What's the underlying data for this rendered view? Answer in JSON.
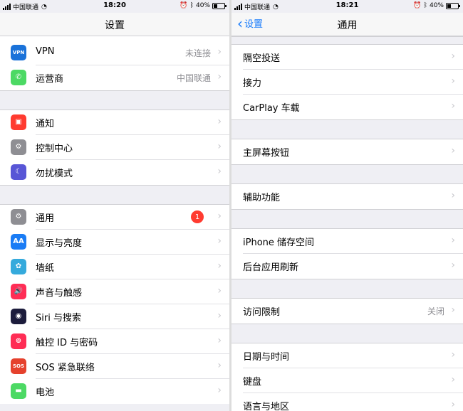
{
  "left": {
    "status": {
      "carrier": "中国联通",
      "time": "18:20",
      "battery": "40%"
    },
    "title": "设置",
    "groups": [
      [
        {
          "label": "VPN",
          "detail": "未连接",
          "icon": "vpn-icon",
          "icon_text": "VPN",
          "color": "#1a72d9"
        },
        {
          "label": "运营商",
          "detail": "中国联通",
          "icon": "phone-icon",
          "icon_text": "✆",
          "color": "#4cd964"
        }
      ],
      [
        {
          "label": "通知",
          "icon": "notification-icon",
          "icon_text": "▣",
          "color": "#ff3b30"
        },
        {
          "label": "控制中心",
          "icon": "control-center-icon",
          "icon_text": "⚙",
          "color": "#8e8e93"
        },
        {
          "label": "勿扰模式",
          "icon": "moon-icon",
          "icon_text": "☾",
          "color": "#5856d6"
        }
      ],
      [
        {
          "label": "通用",
          "badge": "1",
          "icon": "gear-icon",
          "icon_text": "⚙",
          "color": "#8e8e93"
        },
        {
          "label": "显示与亮度",
          "icon": "display-icon",
          "icon_text": "AA",
          "color": "#1a7cf5"
        },
        {
          "label": "墙纸",
          "icon": "wallpaper-icon",
          "icon_text": "✿",
          "color": "#35aadc"
        },
        {
          "label": "声音与触感",
          "icon": "sound-icon",
          "icon_text": "🔊",
          "color": "#ff2d55"
        },
        {
          "label": "Siri 与搜索",
          "icon": "siri-icon",
          "icon_text": "◉",
          "color": "#1c1c3c"
        },
        {
          "label": "触控 ID 与密码",
          "icon": "fingerprint-icon",
          "icon_text": "⊚",
          "color": "#ff2d55"
        },
        {
          "label": "SOS 紧急联络",
          "icon": "sos-icon",
          "icon_text": "SOS",
          "color": "#e5412d"
        },
        {
          "label": "电池",
          "icon": "battery-icon",
          "icon_text": "▬",
          "color": "#4cd964"
        }
      ]
    ]
  },
  "right": {
    "status": {
      "carrier": "中国联通",
      "time": "18:21",
      "battery": "40%"
    },
    "back": "设置",
    "title": "通用",
    "groups": [
      [
        {
          "label": "隔空投送"
        },
        {
          "label": "接力"
        },
        {
          "label": "CarPlay 车载"
        }
      ],
      [
        {
          "label": "主屏幕按钮"
        }
      ],
      [
        {
          "label": "辅助功能"
        }
      ],
      [
        {
          "label": "iPhone 储存空间"
        },
        {
          "label": "后台应用刷新"
        }
      ],
      [
        {
          "label": "访问限制",
          "detail": "关闭"
        }
      ],
      [
        {
          "label": "日期与时间"
        },
        {
          "label": "键盘"
        },
        {
          "label": "语言与地区"
        }
      ]
    ]
  },
  "battery_level": 0.4
}
